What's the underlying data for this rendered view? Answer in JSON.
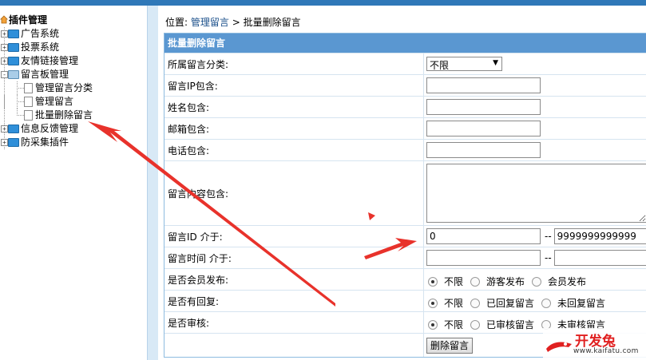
{
  "tree": {
    "root_label": "插件管理",
    "nodes": [
      {
        "label": "广告系统"
      },
      {
        "label": "投票系统"
      },
      {
        "label": "友情链接管理"
      },
      {
        "label": "留言板管理"
      },
      {
        "label": "信息反馈管理"
      },
      {
        "label": "防采集插件"
      }
    ],
    "subnodes": [
      {
        "label": "管理留言分类"
      },
      {
        "label": "管理留言"
      },
      {
        "label": "批量删除留言"
      }
    ]
  },
  "breadcrumb": {
    "prefix": "位置: ",
    "link": "管理留言",
    "separator": " > ",
    "current": "批量删除留言"
  },
  "form": {
    "title": "批量删除留言",
    "category_label": "所属留言分类:",
    "category_selected": "不限",
    "ip_label": "留言IP包含:",
    "name_label": "姓名包含:",
    "email_label": "邮箱包含:",
    "phone_label": "电话包含:",
    "content_label": "留言内容包含:",
    "id_label": "留言ID 介于:",
    "id_from": "0",
    "id_dash": "--",
    "id_to": "9999999999999",
    "time_label": "留言时间 介于:",
    "time_dash": "--",
    "member_label": "是否会员发布:",
    "member_options": [
      "不限",
      "游客发布",
      "会员发布"
    ],
    "reply_label": "是否有回复:",
    "reply_options": [
      "不限",
      "已回复留言",
      "未回复留言"
    ],
    "audit_label": "是否审核:",
    "audit_options": [
      "不限",
      "已审核留言",
      "未审核留言"
    ],
    "submit_label": "删除留言"
  },
  "watermark": {
    "brand": "开发兔",
    "url": "www.kaifatu.com"
  },
  "colors": {
    "header_blue": "#5a97d1",
    "annotation_red": "#e8322b",
    "folder_blue": "#2f8fd9"
  }
}
